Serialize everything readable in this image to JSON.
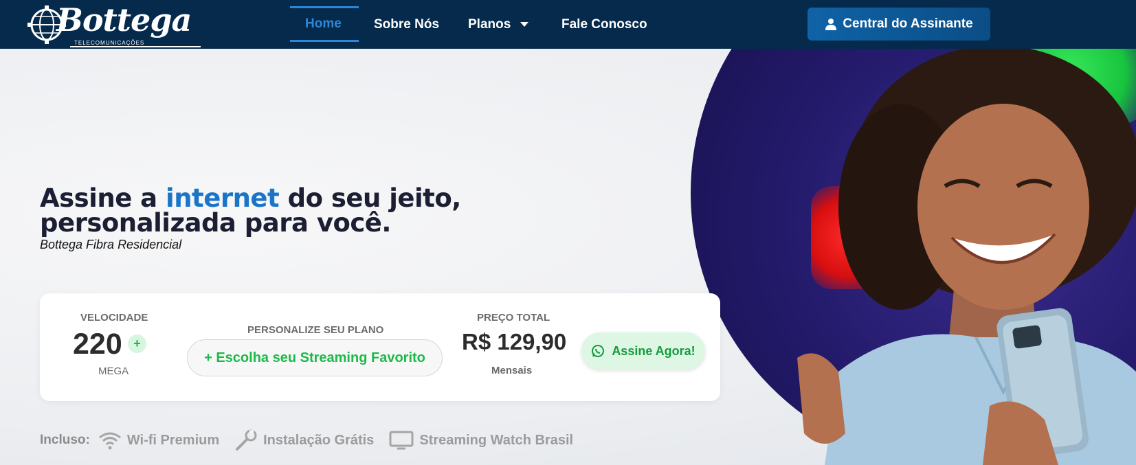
{
  "brand": {
    "name": "Bottega",
    "tagline": "TELECOMUNICAÇÕES"
  },
  "nav": {
    "items": [
      {
        "label": "Home",
        "active": true
      },
      {
        "label": "Sobre Nós"
      },
      {
        "label": "Planos",
        "has_dropdown": true
      },
      {
        "label": "Fale Conosco"
      }
    ],
    "cta_label": "Central do Assinante"
  },
  "hero": {
    "headline_pre": "Assine a ",
    "headline_highlight": "internet",
    "headline_post": " do seu jeito, personalizada para você.",
    "subline": "Bottega Fibra Residencial"
  },
  "plan": {
    "speed_label": "VELOCIDADE",
    "speed_value": "220",
    "speed_unit": "MEGA",
    "plus": "+",
    "customize_label": "PERSONALIZE SEU PLANO",
    "customize_button": "+ Escolha seu Streaming Favorito",
    "price_label": "PREÇO TOTAL",
    "price_value": "R$ 129,90",
    "price_period": "Mensais",
    "subscribe_button": "Assine Agora!"
  },
  "included": {
    "label": "Incluso:",
    "items": [
      {
        "label": "Wi-fi Premium",
        "icon": "wifi-icon"
      },
      {
        "label": "Instalação Grátis",
        "icon": "wrench-icon"
      },
      {
        "label": "Streaming Watch Brasil",
        "icon": "tv-icon"
      }
    ]
  },
  "colors": {
    "navbar": "#052a4c",
    "accent_blue": "#1a75c7",
    "green": "#1cb948"
  }
}
